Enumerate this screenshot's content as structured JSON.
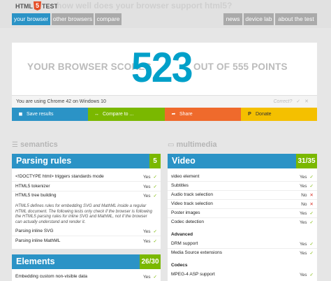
{
  "header": {
    "logo_left": "HTML",
    "logo_five": "5",
    "logo_right": "TEST",
    "tagline": "how well does your browser support html5?",
    "tabs": [
      {
        "label": "your browser",
        "active": true
      },
      {
        "label": "other browsers",
        "active": false
      },
      {
        "label": "compare",
        "active": false
      }
    ],
    "right_tabs": [
      {
        "label": "news"
      },
      {
        "label": "device lab"
      },
      {
        "label": "about the test"
      }
    ]
  },
  "score": {
    "prefix": "YOUR BROWSER SCORES",
    "value": "523",
    "suffix": "OUT OF 555 POINTS",
    "color": "#00a0c9"
  },
  "usage": {
    "text": "You are using Chrome 42 on Windows 10",
    "correct": "Correct?"
  },
  "actions": [
    {
      "label": "Save results",
      "color": "#2b93c6"
    },
    {
      "label": "Compare to ...",
      "color": "#7ab800"
    },
    {
      "label": "Share",
      "color": "#ef6a2c"
    },
    {
      "label": "Donate",
      "color": "#f4c000"
    }
  ],
  "sections": {
    "left": "semantics",
    "right": "multimedia"
  },
  "parsing": {
    "title": "Parsing rules",
    "count": "5",
    "color": "#7ab800",
    "rows": [
      {
        "label": "<!DOCTYPE html> triggers standards mode",
        "result": "Yes"
      },
      {
        "label": "HTML5 tokenizer",
        "result": "Yes"
      },
      {
        "label": "HTML5 tree building",
        "result": "Yes"
      }
    ],
    "note": "HTML5 defines rules for embedding SVG and MathML inside a regular HTML document. The following tests only check if the browser is following the HTML5 parsing rules for inline SVG and MathML, not if the browser can actually understand and render it.",
    "rows2": [
      {
        "label": "Parsing inline SVG",
        "result": "Yes"
      },
      {
        "label": "Parsing inline MathML",
        "result": "Yes"
      }
    ]
  },
  "elements": {
    "title": "Elements",
    "count": "26/30",
    "color": "#7ab800",
    "rows": [
      {
        "label": "Embedding custom non-visible data",
        "result": "Yes"
      }
    ]
  },
  "video": {
    "title": "Video",
    "count": "31/35",
    "color": "#7ab800",
    "rows": [
      {
        "label": "video element",
        "result": "Yes"
      },
      {
        "label": "Subtitles",
        "result": "Yes"
      },
      {
        "label": "Audio track selection",
        "result": "No"
      },
      {
        "label": "Video track selection",
        "result": "No"
      },
      {
        "label": "Poster images",
        "result": "Yes"
      },
      {
        "label": "Codec detection",
        "result": "Yes"
      }
    ],
    "advanced_title": "Advanced",
    "advanced_rows": [
      {
        "label": "DRM support",
        "result": "Yes"
      },
      {
        "label": "Media Source extensions",
        "result": "Yes"
      }
    ],
    "codecs_title": "Codecs",
    "codecs_rows": [
      {
        "label": "MPEG-4 ASP support",
        "result": "Yes"
      }
    ]
  },
  "icons": {
    "check": "check-icon",
    "cross": "cross-icon"
  }
}
